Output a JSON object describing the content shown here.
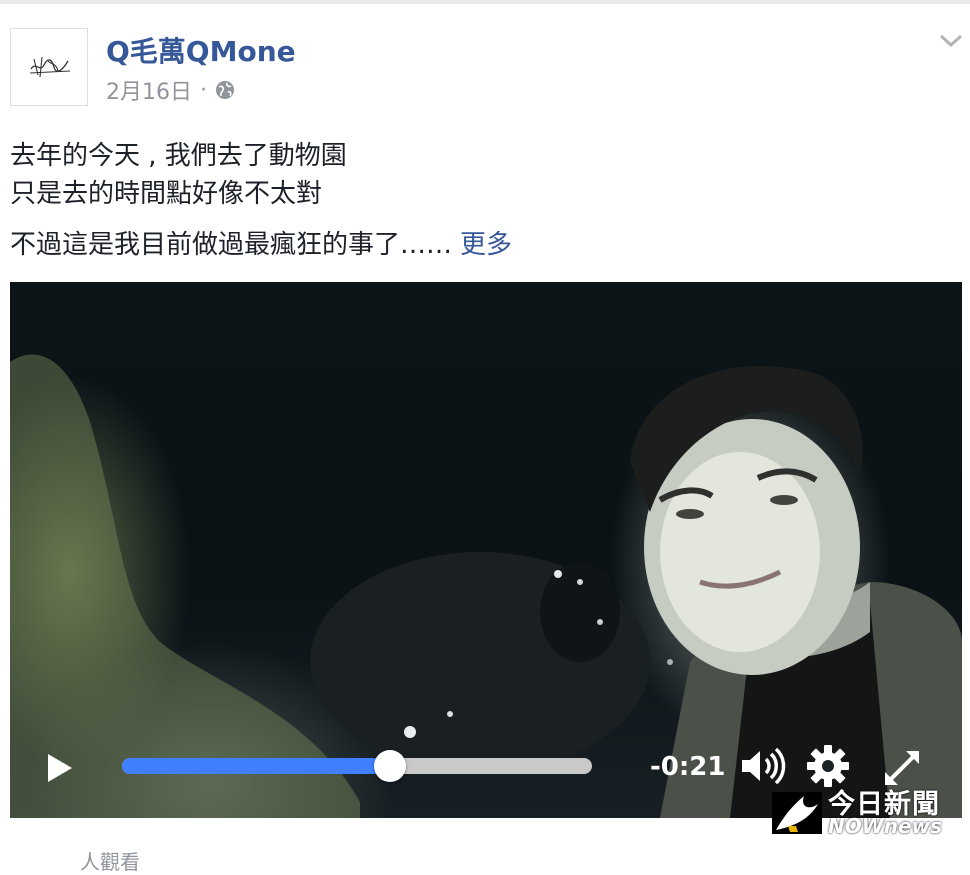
{
  "post": {
    "page_name": "Q毛萬QMone",
    "date": "2月16日",
    "separator": "·",
    "privacy_icon": "globe-icon",
    "menu_icon": "chevron-down-icon",
    "lines": [
      "去年的今天 , 我們去了動物園",
      "只是去的時間點好像不太對",
      "不過這是我目前做過最瘋狂的事了……"
    ],
    "see_more": "更多"
  },
  "video": {
    "remaining_time": "-0:21",
    "progress_fraction": 0.57,
    "progress_color": "#4080ff",
    "controls": [
      "play-icon",
      "volume-icon",
      "gear-icon",
      "fullscreen-icon"
    ]
  },
  "watermark": {
    "chinese": "今日新聞",
    "english": "NOWnews"
  },
  "footer": {
    "partial_text": "人觀看"
  }
}
